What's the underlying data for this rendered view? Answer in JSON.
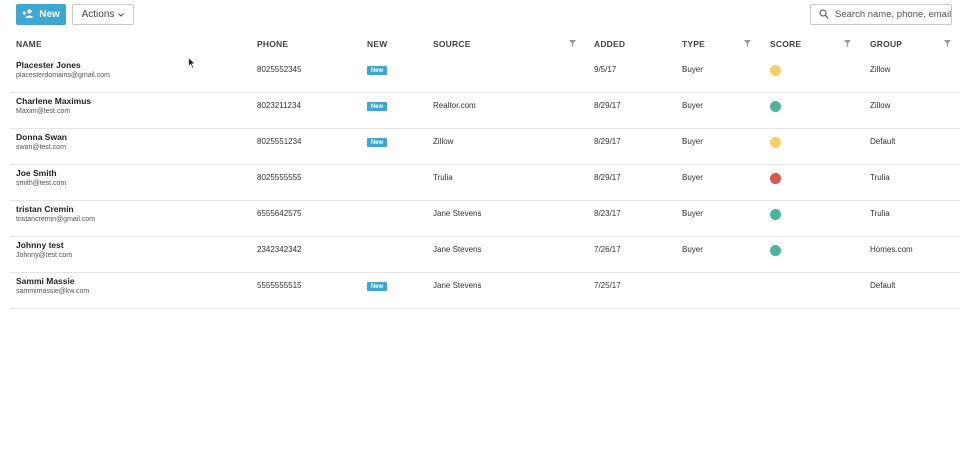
{
  "toolbar": {
    "new_label": "New",
    "actions_label": "Actions",
    "search_placeholder": "Search name, phone, email"
  },
  "columns": {
    "name": "NAME",
    "phone": "PHONE",
    "new": "NEW",
    "source": "SOURCE",
    "added": "ADDED",
    "type": "TYPE",
    "score": "SCORE",
    "group": "GROUP"
  },
  "colors": {
    "accent": "#3ea7d1",
    "score_yellow": "#f3cf6a",
    "score_green": "#4db39d",
    "score_red": "#d9534f"
  },
  "rows": [
    {
      "name": "Placester Jones",
      "email": "placesterdomains@gmail.com",
      "phone": "8025552345",
      "new": "New",
      "source": "",
      "added": "9/5/17",
      "type": "Buyer",
      "score_color": "#f3cf6a",
      "group": "Zillow"
    },
    {
      "name": "Charlene Maximus",
      "email": "Maxim@test.com",
      "phone": "8023211234",
      "new": "New",
      "source": "Realtor.com",
      "added": "8/29/17",
      "type": "Buyer",
      "score_color": "#4db39d",
      "group": "Zillow"
    },
    {
      "name": "Donna Swan",
      "email": "swan@test.com",
      "phone": "8025551234",
      "new": "New",
      "source": "Zillow",
      "added": "8/29/17",
      "type": "Buyer",
      "score_color": "#f3cf6a",
      "group": "Default"
    },
    {
      "name": "Joe Smith",
      "email": "smith@test.com",
      "phone": "8025555555",
      "new": "",
      "source": "Trulia",
      "added": "8/29/17",
      "type": "Buyer",
      "score_color": "#d9534f",
      "group": "Trulia"
    },
    {
      "name": "tristan Cremin",
      "email": "tristancremin@gmail.com",
      "phone": "6555642575",
      "new": "",
      "source": "Jane Stevens",
      "added": "8/23/17",
      "type": "Buyer",
      "score_color": "#4db39d",
      "group": "Trulia"
    },
    {
      "name": "Johnny test",
      "email": "Johnny@test.com",
      "phone": "2342342342",
      "new": "",
      "source": "Jane Stevens",
      "added": "7/26/17",
      "type": "Buyer",
      "score_color": "#4db39d",
      "group": "Homes.com"
    },
    {
      "name": "Sammi Massie",
      "email": "sammimassie@kw.com",
      "phone": "5555555515",
      "new": "New",
      "source": "Jane Stevens",
      "added": "7/25/17",
      "type": "",
      "score_color": "",
      "group": "Default"
    }
  ]
}
